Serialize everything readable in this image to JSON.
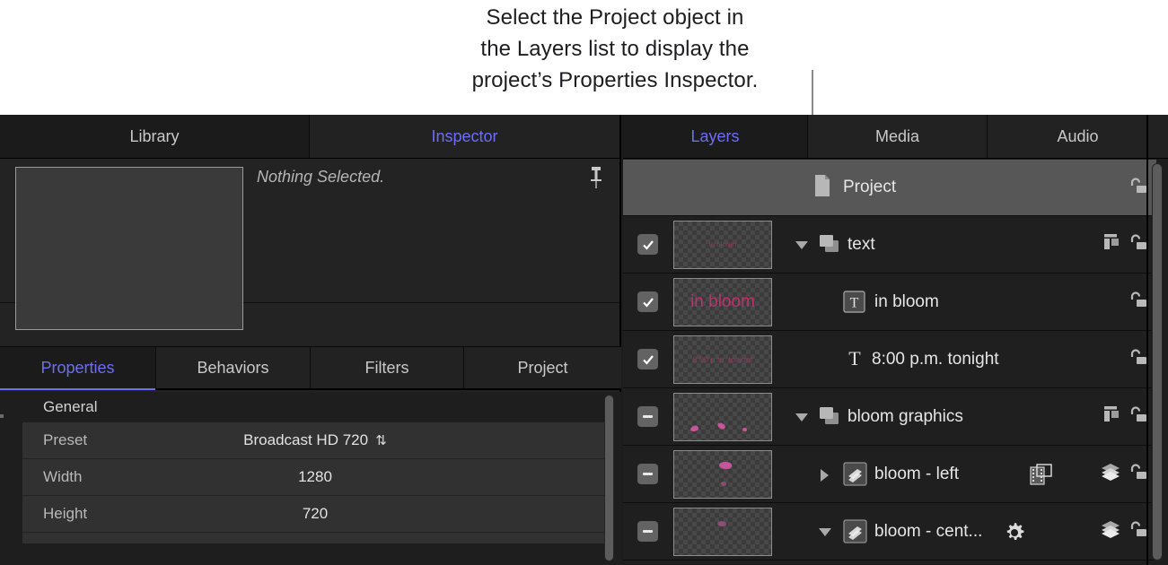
{
  "callout": {
    "text": "Select the Project object in\nthe Layers list to display the\nproject’s Properties Inspector.",
    "leader_color": "#8a8a8a"
  },
  "accent_color": "#6d6ef6",
  "left_panel": {
    "top_tabs": [
      {
        "label": "Library",
        "active": false
      },
      {
        "label": "Inspector",
        "active": true
      }
    ],
    "preview": {
      "status_text": "Nothing Selected.",
      "pin_icon": "pin-icon"
    },
    "sub_tabs": [
      {
        "label": "Properties",
        "active": true
      },
      {
        "label": "Behaviors",
        "active": false
      },
      {
        "label": "Filters",
        "active": false
      },
      {
        "label": "Project",
        "active": false
      }
    ],
    "properties": {
      "group_label": "General",
      "rows": [
        {
          "label": "Preset",
          "value": "Broadcast HD 720",
          "stepper": "⌃⌄"
        },
        {
          "label": "Width",
          "value": "1280",
          "stepper": ""
        },
        {
          "label": "Height",
          "value": "720",
          "stepper": ""
        }
      ]
    }
  },
  "right_panel": {
    "top_tabs": [
      {
        "label": "Layers",
        "active": true
      },
      {
        "label": "Media",
        "active": false
      },
      {
        "label": "Audio",
        "active": false
      }
    ],
    "layers": [
      {
        "name": "Project",
        "selected": true,
        "checkbox": "none",
        "thumbnail": "none",
        "thumb_text": "",
        "disclosure": "none",
        "type_icon": "document-icon",
        "extra_icon": "none",
        "right_icons": [
          "unlock-icon"
        ]
      },
      {
        "name": "text",
        "selected": false,
        "checkbox": "checked",
        "thumbnail": "checker",
        "thumb_text": "in bloom",
        "thumb_text_size": "tiny",
        "disclosure": "down",
        "type_icon": "group-icon",
        "extra_icon": "none",
        "right_icons": [
          "collapse-icon",
          "unlock-icon"
        ]
      },
      {
        "name": "in bloom",
        "selected": false,
        "checkbox": "checked",
        "thumbnail": "checker",
        "thumb_text": "in bloom",
        "thumb_text_size": "normal",
        "disclosure": "none",
        "type_icon": "text-boxed-icon",
        "extra_icon": "none",
        "right_icons": [
          "unlock-icon"
        ]
      },
      {
        "name": "8:00 p.m. tonight",
        "selected": false,
        "checkbox": "checked",
        "thumbnail": "checker",
        "thumb_text": "8:00 p.m. tonight",
        "thumb_text_size": "small",
        "disclosure": "none",
        "type_icon": "text-plain-icon",
        "extra_icon": "none",
        "right_icons": [
          "unlock-icon"
        ]
      },
      {
        "name": "bloom graphics",
        "selected": false,
        "checkbox": "minus",
        "thumbnail": "petals",
        "thumb_text": "",
        "disclosure": "down",
        "type_icon": "group-icon",
        "extra_icon": "none",
        "right_icons": [
          "collapse-icon",
          "unlock-icon"
        ]
      },
      {
        "name": "bloom - left",
        "selected": false,
        "checkbox": "minus",
        "thumbnail": "petals",
        "thumb_text": "",
        "disclosure": "right",
        "type_icon": "particle-icon",
        "extra_icon": "filmstrip-icon",
        "right_icons": [
          "stack-icon",
          "unlock-icon"
        ]
      },
      {
        "name": "bloom - cent...",
        "selected": false,
        "checkbox": "minus",
        "thumbnail": "petals",
        "thumb_text": "",
        "disclosure": "down",
        "type_icon": "particle-icon",
        "extra_icon": "gear-icon",
        "right_icons": [
          "stack-icon",
          "unlock-icon"
        ]
      }
    ]
  }
}
